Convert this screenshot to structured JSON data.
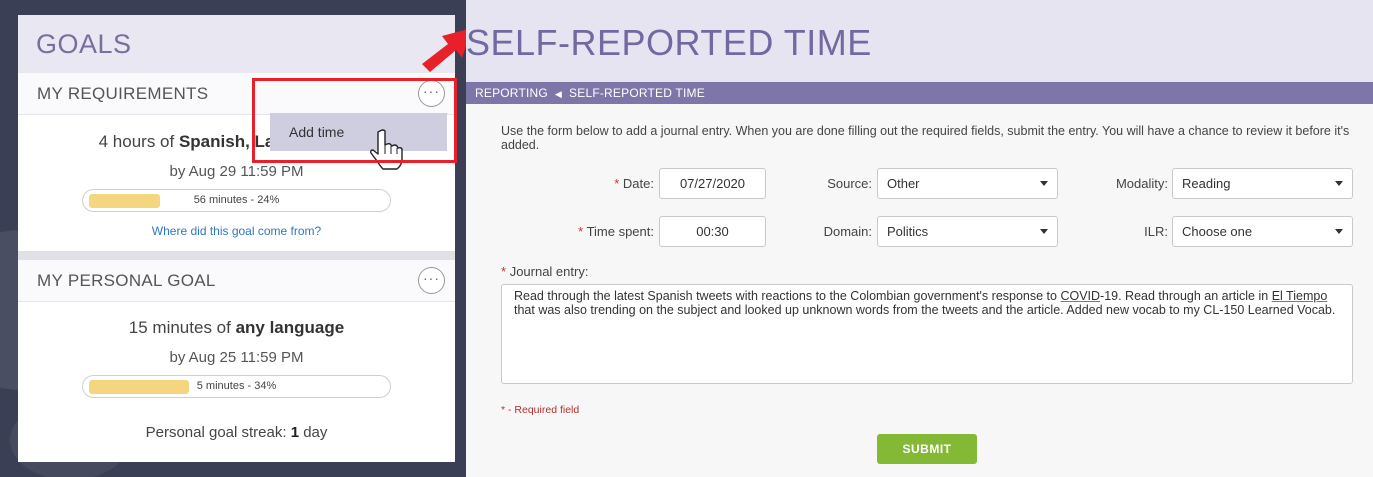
{
  "goals": {
    "title": "GOALS",
    "requirements": {
      "header": "MY REQUIREMENTS",
      "more_label": "···",
      "goal_prefix": "4 hours of ",
      "goal_language": "Spanish, La",
      "due": "by Aug 29 11:59 PM",
      "progress_text": "56 minutes - 24%",
      "progress_fraction": 0.24,
      "link": "Where did this goal come from?"
    },
    "menu": {
      "add_time": "Add time"
    },
    "personal": {
      "header": "MY PERSONAL GOAL",
      "more_label": "···",
      "goal_prefix": "15 minutes of ",
      "goal_language": "any language",
      "due": "by Aug 25 11:59 PM",
      "progress_text": "5 minutes - 34%",
      "progress_fraction": 0.34,
      "streak_prefix": "Personal goal streak: ",
      "streak_value": "1",
      "streak_suffix": " day"
    }
  },
  "page": {
    "title": "SELF-REPORTED TIME",
    "breadcrumb": {
      "parent": "REPORTING",
      "current": "SELF-REPORTED TIME"
    },
    "intro": "Use the form below to add a journal entry. When you are done filling out the required fields, submit the entry. You will have a chance to review it before it's added.",
    "form": {
      "date_label": "Date:",
      "date_value": "07/27/2020",
      "time_label": "Time spent:",
      "time_value": "00:30",
      "source_label": "Source:",
      "source_value": "Other",
      "domain_label": "Domain:",
      "domain_value": "Politics",
      "modality_label": "Modality:",
      "modality_value": "Reading",
      "ilr_label": "ILR:",
      "ilr_value": "Choose one",
      "journal_label": "Journal entry:",
      "journal_value": {
        "p1": "Read through the latest Spanish tweets with reactions to the Colombian government's response to ",
        "covid": "COVID",
        "p2": "-19. Read through an article in ",
        "eltiempo": "El Tiempo",
        "p3": " that was also trending on the subject and looked up unknown words from the tweets and the article. Added new vocab to my CL-150 Learned Vocab."
      },
      "required_star": "*",
      "required_note": "* - Required field",
      "submit": "SUBMIT"
    }
  },
  "colors": {
    "accent": "#7e75a8",
    "highlight": "#e8202a",
    "submit": "#84b935",
    "progress": "#f5d680"
  }
}
